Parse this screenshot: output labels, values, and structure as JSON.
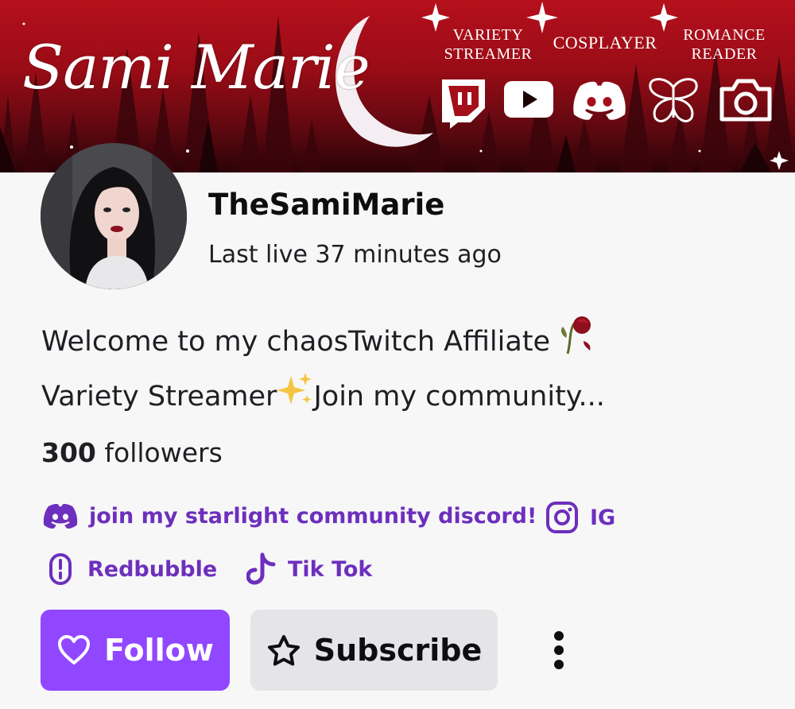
{
  "banner": {
    "title": "Sami Marie",
    "tags": {
      "variety": "VARIETY\nSTREAMER",
      "variety_line1": "VARIETY",
      "variety_line2": "STREAMER",
      "cosplayer": "COSPLAYER",
      "romance_line1": "ROMANCE",
      "romance_line2": "READER"
    },
    "icons": [
      "twitch-icon",
      "youtube-icon",
      "discord-icon",
      "butterfly-icon",
      "camera-icon"
    ],
    "background_color": "#a50f1a"
  },
  "channel": {
    "name": "TheSamiMarie",
    "last_live": "Last live 37 minutes ago"
  },
  "bio": {
    "line1": "Welcome to my chaosTwitch Affiliate",
    "line2_a": "Variety Streamer",
    "line2_b": "Join my community..."
  },
  "followers": {
    "count": "300",
    "label": " followers"
  },
  "links": [
    {
      "icon": "discord-icon",
      "label": "join my starlight community discord!"
    },
    {
      "icon": "instagram-icon",
      "label": "IG"
    },
    {
      "icon": "redbubble-icon",
      "label": "Redbubble"
    },
    {
      "icon": "tiktok-icon",
      "label": "Tik Tok"
    }
  ],
  "actions": {
    "follow_label": "Follow",
    "subscribe_label": "Subscribe",
    "more_icon": "more-vertical-icon"
  },
  "colors": {
    "accent": "#9147ff",
    "link": "#6d2fbd",
    "secondary_button": "#e5e5e8",
    "page_background": "#f7f7f8"
  }
}
